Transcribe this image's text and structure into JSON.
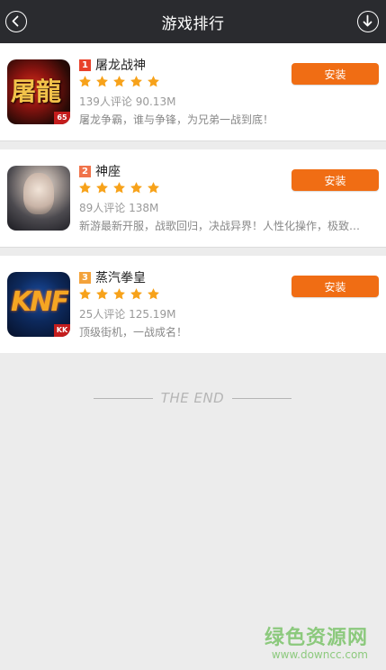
{
  "header": {
    "title": "游戏排行",
    "back_icon": "chevron-left-circle-icon",
    "download_icon": "arrow-down-circle-icon"
  },
  "colors": {
    "header_bg": "#2a2b2f",
    "install_button": "#f06d14",
    "star": "#f7a21a",
    "rank1": "#e8412a",
    "rank2": "#f0734a",
    "rank3": "#f3a23a"
  },
  "games": [
    {
      "rank": "1",
      "name": "屠龙战神",
      "rating": 5,
      "meta": "139人评论 90.13M",
      "description": "屠龙争霸，谁与争锋，为兄弟一战到底！",
      "install_label": "安装",
      "icon_glyph": "屠龍",
      "icon_badge": "65"
    },
    {
      "rank": "2",
      "name": "神座",
      "rating": 5,
      "meta": "89人评论 138M",
      "description": "新游最新开服，战歌回归，决战异界！人性化操作，极致…",
      "install_label": "安装"
    },
    {
      "rank": "3",
      "name": "蒸汽拳皇",
      "rating": 5,
      "meta": "25人评论 125.19M",
      "description": "顶级街机，一战成名！",
      "install_label": "安装",
      "icon_glyph": "KNF",
      "icon_badge": "KK"
    }
  ],
  "footer": {
    "end_text": "THE END"
  },
  "watermark": {
    "title": "绿色资源网",
    "url": "www.downcc.com"
  }
}
